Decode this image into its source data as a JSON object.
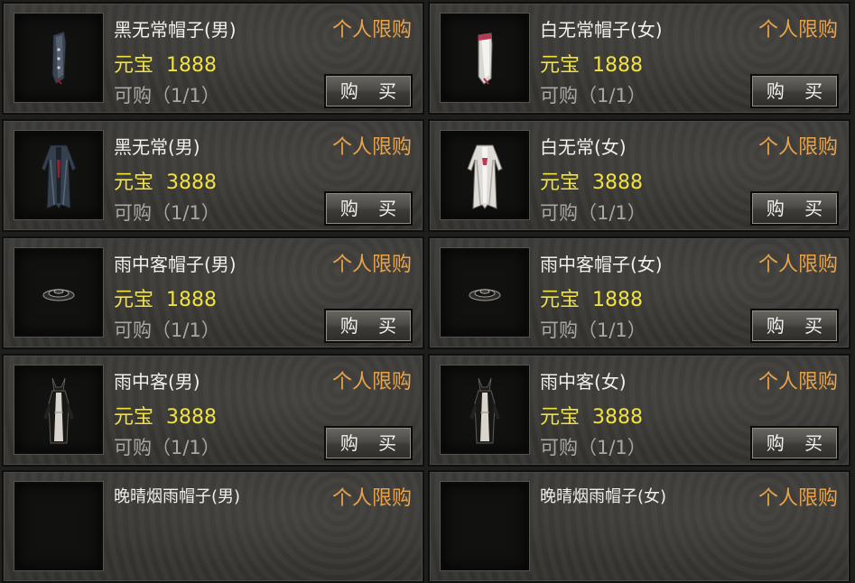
{
  "currency_label": "元宝",
  "buy_label": "购 买",
  "items": [
    {
      "name": "黑无常帽子(男)",
      "tag": "个人限购",
      "price": "1888",
      "limit": "可购（1/1）",
      "icon": "black-hat-icon"
    },
    {
      "name": "白无常帽子(女)",
      "tag": "个人限购",
      "price": "1888",
      "limit": "可购（1/1）",
      "icon": "white-hat-icon"
    },
    {
      "name": "黑无常(男)",
      "tag": "个人限购",
      "price": "3888",
      "limit": "可购（1/1）",
      "icon": "black-robe-icon"
    },
    {
      "name": "白无常(女)",
      "tag": "个人限购",
      "price": "3888",
      "limit": "可购（1/1）",
      "icon": "white-robe-icon"
    },
    {
      "name": "雨中客帽子(男)",
      "tag": "个人限购",
      "price": "1888",
      "limit": "可购（1/1）",
      "icon": "straw-hat-icon"
    },
    {
      "name": "雨中客帽子(女)",
      "tag": "个人限购",
      "price": "1888",
      "limit": "可购（1/1）",
      "icon": "straw-hat-icon"
    },
    {
      "name": "雨中客(男)",
      "tag": "个人限购",
      "price": "3888",
      "limit": "可购（1/1）",
      "icon": "rain-robe-icon"
    },
    {
      "name": "雨中客(女)",
      "tag": "个人限购",
      "price": "3888",
      "limit": "可购（1/1）",
      "icon": "rain-robe-icon"
    },
    {
      "name": "晚晴烟雨帽子(男)",
      "tag": "个人限购",
      "price": "",
      "limit": "",
      "icon": "item-slot-icon"
    },
    {
      "name": "晚晴烟雨帽子(女)",
      "tag": "个人限购",
      "price": "",
      "limit": "",
      "icon": "item-slot-icon"
    }
  ]
}
